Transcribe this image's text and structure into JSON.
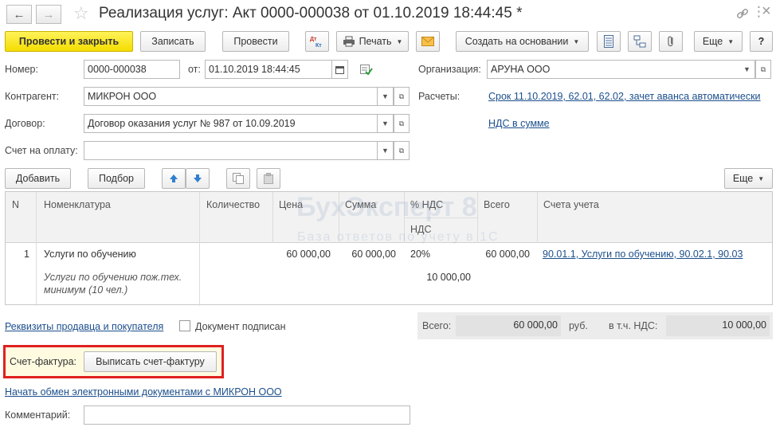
{
  "window": {
    "title": "Реализация услуг: Акт 0000-000038 от 01.10.2019 18:44:45 *"
  },
  "icons": {
    "back": "←",
    "forward": "→",
    "star": "☆",
    "link": "🔗",
    "more": "⋮",
    "close": "×"
  },
  "toolbar": {
    "post_close": "Провести и закрыть",
    "save": "Записать",
    "post": "Провести",
    "print": "Печать",
    "create_based": "Создать на основании",
    "more": "Еще",
    "help": "?"
  },
  "form": {
    "number_label": "Номер:",
    "number_value": "0000-000038",
    "date_label": "от:",
    "date_value": "01.10.2019 18:44:45",
    "org_label": "Организация:",
    "org_value": "АРУНА ООО",
    "counterparty_label": "Контрагент:",
    "counterparty_value": "МИКРОН ООО",
    "settlements_label": "Расчеты:",
    "settlements_link": "Срок 11.10.2019, 62.01, 62.02, зачет аванса автоматически",
    "contract_label": "Договор:",
    "contract_value": "Договор оказания услуг № 987 от 10.09.2019",
    "vat_link": "НДС в сумме",
    "invoice_label": "Счет на оплату:",
    "invoice_value": ""
  },
  "table_toolbar": {
    "add": "Добавить",
    "pick": "Подбор",
    "more": "Еще"
  },
  "table": {
    "headers": {
      "n": "N",
      "item": "Номенклатура",
      "qty": "Количество",
      "price": "Цена",
      "sum": "Сумма",
      "vat_pct": "% НДС",
      "vat": "НДС",
      "total": "Всего",
      "account": "Счета учета"
    },
    "rows": [
      {
        "n": "1",
        "item": "Услуги по обучению",
        "item_desc_1": "Услуги по обучению пож.тех.",
        "item_desc_2": "минимум (10 чел.)",
        "qty": "",
        "price": "60 000,00",
        "sum": "60 000,00",
        "vat_pct": "20%",
        "vat": "10 000,00",
        "total": "60 000,00",
        "account": "90.01.1, Услуги по обучению, 90.02.1, 90.03"
      }
    ]
  },
  "watermark": {
    "title": "БухЭксперт 8",
    "subtitle": "База ответов по учету в 1С"
  },
  "footer": {
    "requisites_link": "Реквизиты продавца и покупателя",
    "signed_label": "Документ подписан",
    "total_label": "Всего:",
    "total_value": "60 000,00",
    "currency": "руб.",
    "vat_label": "в т.ч. НДС:",
    "vat_value": "10 000,00",
    "invoice_doc_label": "Счет-фактура:",
    "issue_invoice_button": "Выписать счет-фактуру",
    "edo_link": "Начать обмен электронными документами с МИКРОН ООО",
    "comment_label": "Комментарий:",
    "comment_value": ""
  },
  "colors": {
    "primary_button": "#f4dd00",
    "link": "#1c4f8c",
    "highlight_border": "#e02020"
  }
}
